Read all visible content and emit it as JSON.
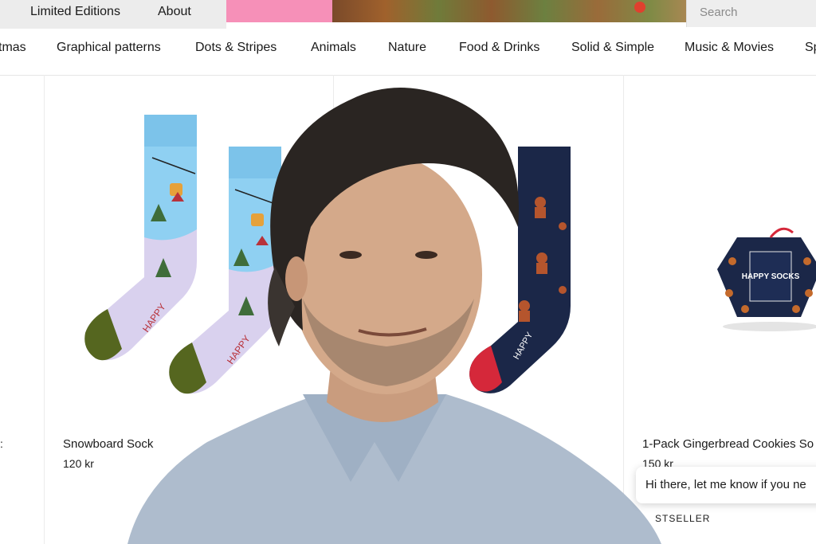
{
  "top_nav": {
    "links": [
      "Limited Editions",
      "About"
    ],
    "search_placeholder": "Search"
  },
  "categories": [
    "tmas",
    "Graphical patterns",
    "Dots & Stripes",
    "Animals",
    "Nature",
    "Food & Drinks",
    "Solid & Simple",
    "Music & Movies",
    "Sp"
  ],
  "products": [
    {
      "name": "Snowboard Sock",
      "price": "120 kr"
    },
    {
      "name": "1-Pack Gingerbread Cookies So",
      "price": "150 kr",
      "badge": "STSELLER"
    }
  ],
  "left_edge_mark": ":",
  "sock_text": "HAPPY",
  "giftbox_text": "HAPPY SOCKS",
  "chat": {
    "message": "Hi there, let me know if you ne"
  },
  "colors": {
    "topbar_gray": "#ececec",
    "pink_block": "#f690b8",
    "sock_blue": "#7cc3ea",
    "sock_lilac": "#d9d1ee",
    "sock_heel_green": "#55661f",
    "navy_sock": "#1b2748",
    "gingerbread": "#b5552d",
    "shirt_blue": "#aebccd"
  }
}
